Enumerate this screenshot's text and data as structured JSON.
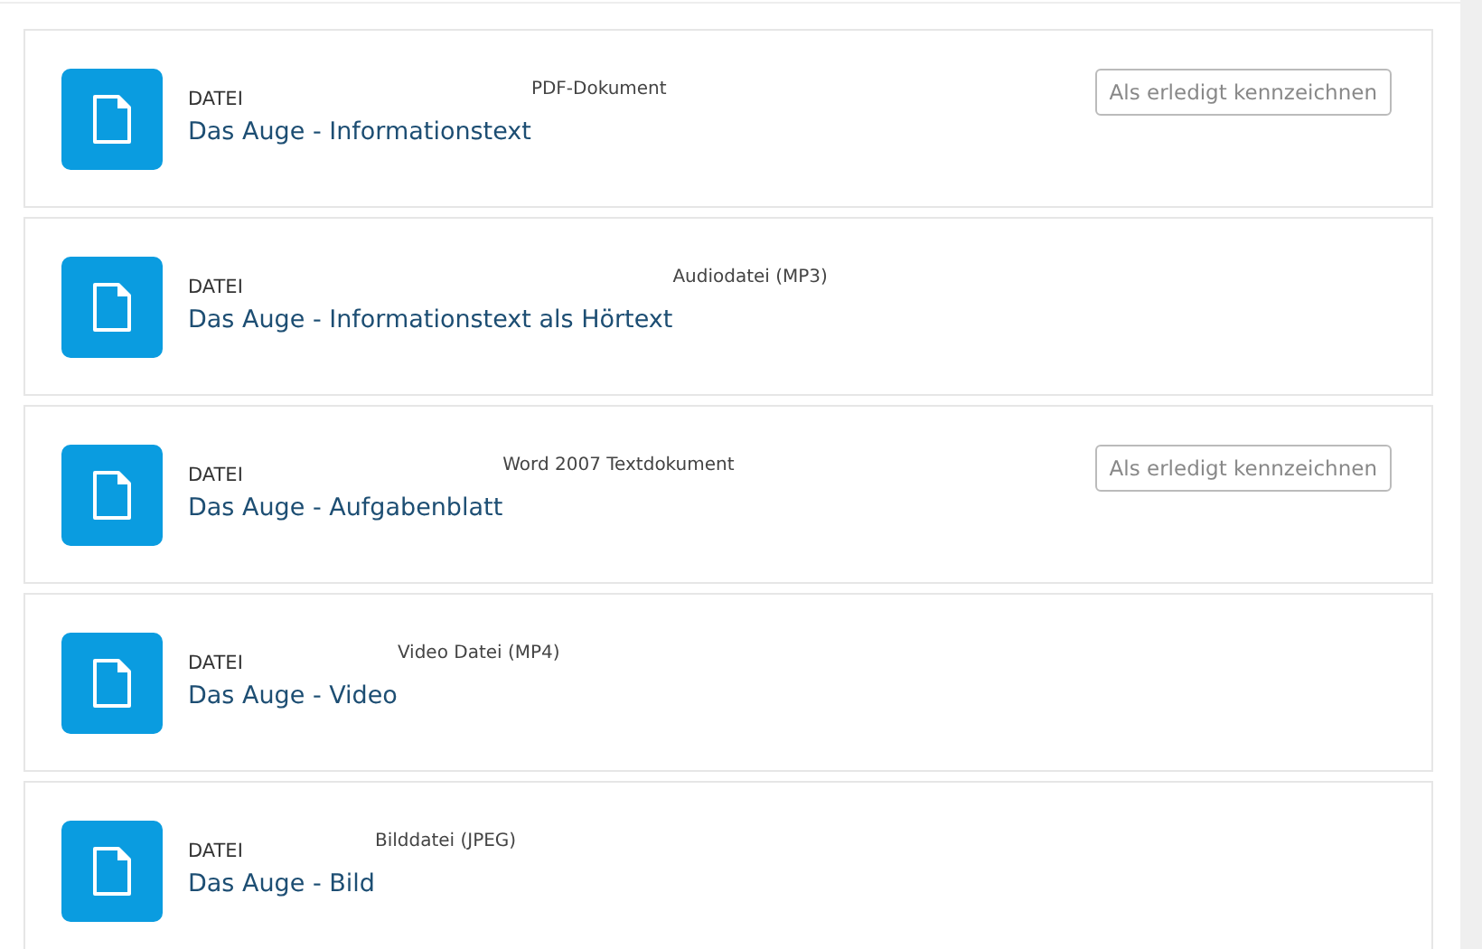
{
  "activities": [
    {
      "kind_label": "DATEI",
      "title": "Das Auge - Informationstext",
      "file_type": "PDF-Dokument",
      "button": "Als erledigt kennzeichnen"
    },
    {
      "kind_label": "DATEI",
      "title": "Das Auge - Informationstext als Hörtext",
      "file_type": "Audiodatei (MP3)"
    },
    {
      "kind_label": "DATEI",
      "title": "Das Auge - Aufgabenblatt",
      "file_type": "Word 2007 Textdokument",
      "button": "Als erledigt kennzeichnen"
    },
    {
      "kind_label": "DATEI",
      "title": "Das Auge - Video",
      "file_type": "Video Datei (MP4)"
    },
    {
      "kind_label": "DATEI",
      "title": "Das Auge - Bild",
      "file_type": "Bilddatei (JPEG)"
    }
  ]
}
